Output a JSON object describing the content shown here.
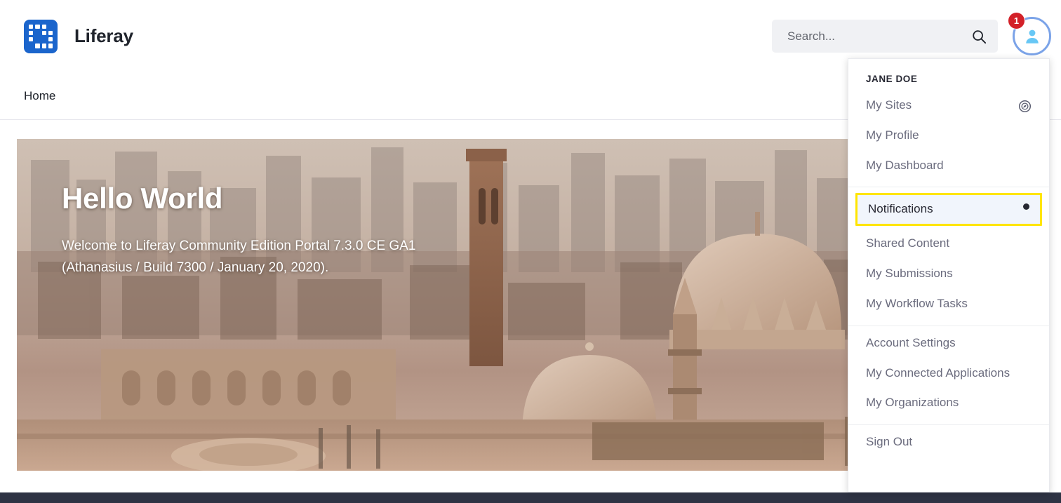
{
  "brand": {
    "name": "Liferay",
    "logo_icon": "liferay-grid-logo",
    "logo_color": "#1b65cc"
  },
  "header": {
    "search": {
      "placeholder": "Search...",
      "value": "",
      "icon": "search-icon"
    },
    "avatar": {
      "icon": "user-avatar-icon",
      "ring_color": "#7ba3e8",
      "badge_count": "1",
      "badge_color": "#d32129"
    }
  },
  "nav": {
    "items": [
      {
        "label": "Home"
      }
    ]
  },
  "hero": {
    "title": "Hello World",
    "subtitle_line1": "Welcome to Liferay Community Edition Portal 7.3.0 CE GA1",
    "subtitle_line2": "(Athanasius / Build 7300 / January 20, 2020).",
    "image_description": "sepia cityscape with mosque domes and minarets"
  },
  "user_menu": {
    "user_name": "JANE DOE",
    "group1": [
      {
        "label": "My Sites",
        "trailing_icon": "compass-icon"
      },
      {
        "label": "My Profile",
        "trailing_icon": ""
      },
      {
        "label": "My Dashboard",
        "trailing_icon": ""
      }
    ],
    "highlighted": {
      "label": "Notifications",
      "trailing_icon": "dot-indicator",
      "highlight_color": "#ffe500",
      "background_color": "#f1f5fc"
    },
    "group2": [
      {
        "label": "Shared Content",
        "trailing_icon": ""
      },
      {
        "label": "My Submissions",
        "trailing_icon": ""
      },
      {
        "label": "My Workflow Tasks",
        "trailing_icon": ""
      }
    ],
    "group3": [
      {
        "label": "Account Settings",
        "trailing_icon": ""
      },
      {
        "label": "My Connected Applications",
        "trailing_icon": ""
      },
      {
        "label": "My Organizations",
        "trailing_icon": ""
      }
    ],
    "group4": [
      {
        "label": "Sign Out",
        "trailing_icon": ""
      }
    ]
  },
  "footer": {
    "color": "#2e3344"
  }
}
